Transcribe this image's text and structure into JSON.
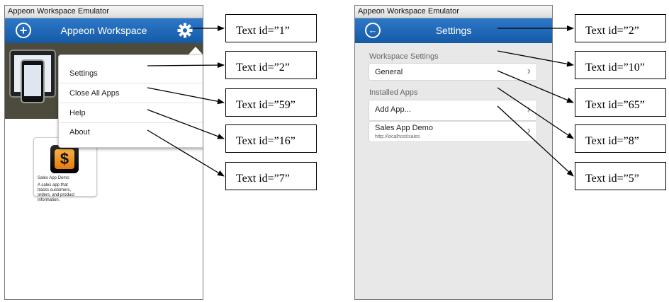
{
  "left_screen": {
    "window_title": "Appeon Workspace Emulator",
    "header_title": "Appeon Workspace",
    "menu_items": [
      "Settings",
      "Close All Apps",
      "Help",
      "About"
    ],
    "app_card": {
      "name": "Sales App Demo",
      "description": "A sales app that tracks customers, orders, and product information.",
      "icon_glyph": "$"
    }
  },
  "right_screen": {
    "window_title": "Appeon Workspace Emulator",
    "header_title": "Settings",
    "section_workspace": "Workspace Settings",
    "general_label": "General",
    "section_installed": "Installed Apps",
    "add_app_label": "Add App...",
    "sales_app_label": "Sales App Demo",
    "sales_app_url": "http://localhost/sales"
  },
  "annotations_left": [
    "Text id=”1”",
    "Text id=”2”",
    "Text id=”59”",
    "Text id=”16”",
    "Text id=”7”"
  ],
  "annotations_right": [
    "Text id=”2”",
    "Text id=”10”",
    "Text id=”65”",
    "Text id=”8”",
    "Text id=”5”"
  ],
  "colors": {
    "header_blue": "#1e65b4",
    "banner": "#4c4b3c",
    "settings_bg": "#e8e8e8"
  }
}
